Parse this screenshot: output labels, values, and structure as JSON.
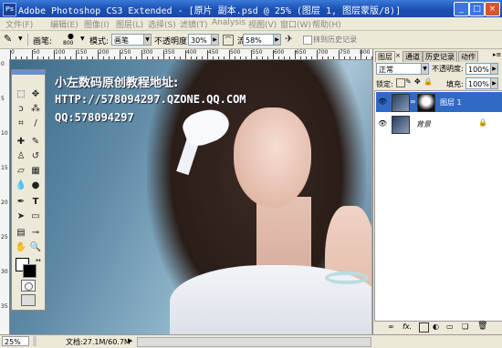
{
  "window": {
    "title": "Adobe Photoshop CS3 Extended - [原片 副本.psd @ 25% (图层 1, 图层蒙版/8)]",
    "app_icon": "Ps",
    "minimize": "_",
    "maximize": "□",
    "close": "×"
  },
  "menu": [
    "文件(F)",
    "编辑(E)",
    "图像(I)",
    "图层(L)",
    "选择(S)",
    "滤镜(T)",
    "Analysis",
    "视图(V)",
    "窗口(W)",
    "帮助(H)"
  ],
  "options": {
    "brush_label": "画笔:",
    "brush_size": "800",
    "mode_label": "模式:",
    "mode_value": "画笔",
    "opacity_label": "不透明度:",
    "opacity_value": "30%",
    "flow_label": "流量:",
    "flow_value": "58%",
    "history_label": "抹到历史记录"
  },
  "ruler": {
    "top": [
      "0",
      "50",
      "100",
      "150",
      "200",
      "250",
      "300",
      "350",
      "400",
      "450",
      "500",
      "550",
      "600",
      "650",
      "700",
      "750",
      "800"
    ],
    "left": [
      "0",
      "5",
      "10",
      "15",
      "20",
      "25",
      "30",
      "35"
    ]
  },
  "canvas": {
    "watermark_line1": "小左数码原创教程地址:",
    "watermark_line2": "HTTP://578094297.QZONE.QQ.COM",
    "watermark_line3": "QQ:578094297"
  },
  "panel": {
    "tabs": [
      "图层",
      "通道",
      "历史记录",
      "动作"
    ],
    "blend_mode": "正常",
    "opacity_label": "不透明度:",
    "opacity_value": "100%",
    "lock_label": "锁定:",
    "fill_label": "填充:",
    "fill_value": "100%",
    "layers": [
      {
        "name": "图层 1",
        "selected": true
      },
      {
        "name": "背景",
        "selected": false
      }
    ],
    "bottom_icons": [
      "link-icon",
      "fx-icon",
      "mask-icon",
      "adjustment-icon",
      "folder-icon",
      "new-layer-icon",
      "trash-icon"
    ]
  },
  "status": {
    "zoom": "25%",
    "doc_info": "文档:27.1M/60.7M"
  },
  "colors": {
    "title_bar": "#1a4fb4",
    "selected_layer": "#316ac5",
    "panel_bg": "#ece9d8"
  }
}
